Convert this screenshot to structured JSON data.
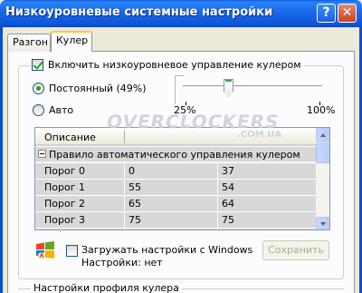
{
  "window": {
    "title": "Низкоуровневые системные настройки",
    "help_button": "?",
    "close_button": "✕"
  },
  "tabs": [
    {
      "label": "Разгон",
      "active": false
    },
    {
      "label": "Кулер",
      "active": true
    }
  ],
  "fan_control": {
    "enable_checkbox_label": "Включить низкоуровневое управление кулером",
    "enable_checked": true,
    "constant_label": "Постоянный (49%)",
    "constant_selected": true,
    "auto_label": "Авто",
    "auto_selected": false,
    "slider_min_label": "25%",
    "slider_max_label": "100%",
    "slider_value_fraction": 0.32
  },
  "table": {
    "header": "Описание",
    "group_label": "Правило автоматического управления кулером",
    "rows": [
      {
        "name": "Порог 0",
        "v1": "0",
        "v2": "37"
      },
      {
        "name": "Порог 1",
        "v1": "55",
        "v2": "54"
      },
      {
        "name": "Порог 2",
        "v1": "65",
        "v2": "64"
      },
      {
        "name": "Порог 3",
        "v1": "75",
        "v2": "75"
      },
      {
        "name": "Порог 4",
        "v1": "80",
        "v2": "81"
      }
    ]
  },
  "watermark": {
    "main": "OVERCLOCKERS",
    "sub": ".COM.UA"
  },
  "startup": {
    "load_checkbox_label": "Загружать настройки с Windows",
    "load_checked": false,
    "settings_line": "Настройки:  нет",
    "save_button": "Сохранить"
  },
  "profile_group": {
    "legend": "Настройки профиля кулера"
  },
  "colors": {
    "titlebar": "#0E55D8",
    "window_bg": "#ECE9D8",
    "group_row_bg": "#D8D8D8"
  }
}
